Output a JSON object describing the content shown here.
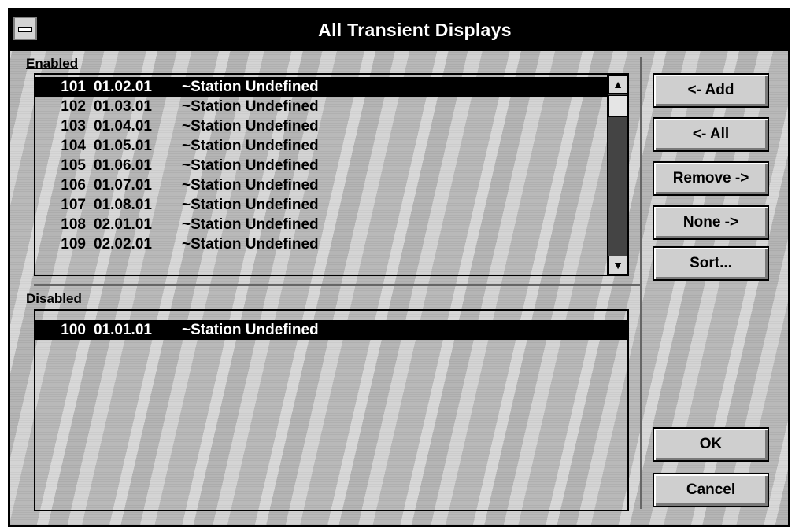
{
  "window": {
    "title": "All Transient Displays"
  },
  "enabled": {
    "label": "Enabled",
    "items": [
      {
        "num": "101",
        "code": "01.02.01",
        "name": "~Station Undefined"
      },
      {
        "num": "102",
        "code": "01.03.01",
        "name": "~Station Undefined"
      },
      {
        "num": "103",
        "code": "01.04.01",
        "name": "~Station Undefined"
      },
      {
        "num": "104",
        "code": "01.05.01",
        "name": "~Station Undefined"
      },
      {
        "num": "105",
        "code": "01.06.01",
        "name": "~Station Undefined"
      },
      {
        "num": "106",
        "code": "01.07.01",
        "name": "~Station Undefined"
      },
      {
        "num": "107",
        "code": "01.08.01",
        "name": "~Station Undefined"
      },
      {
        "num": "108",
        "code": "02.01.01",
        "name": "~Station Undefined"
      },
      {
        "num": "109",
        "code": "02.02.01",
        "name": "~Station Undefined"
      }
    ],
    "selected_index": 0
  },
  "disabled": {
    "label": "Disabled",
    "items": [
      {
        "num": "100",
        "code": "01.01.01",
        "name": "~Station Undefined"
      }
    ],
    "selected_index": 0
  },
  "buttons": {
    "add": "<- Add",
    "all": "<- All",
    "remove": "Remove ->",
    "none": "None ->",
    "sort": "Sort...",
    "ok": "OK",
    "cancel": "Cancel"
  },
  "icons": {
    "system_menu": "system-menu-icon",
    "scroll_up": "up-arrow-icon",
    "scroll_down": "down-arrow-icon"
  }
}
